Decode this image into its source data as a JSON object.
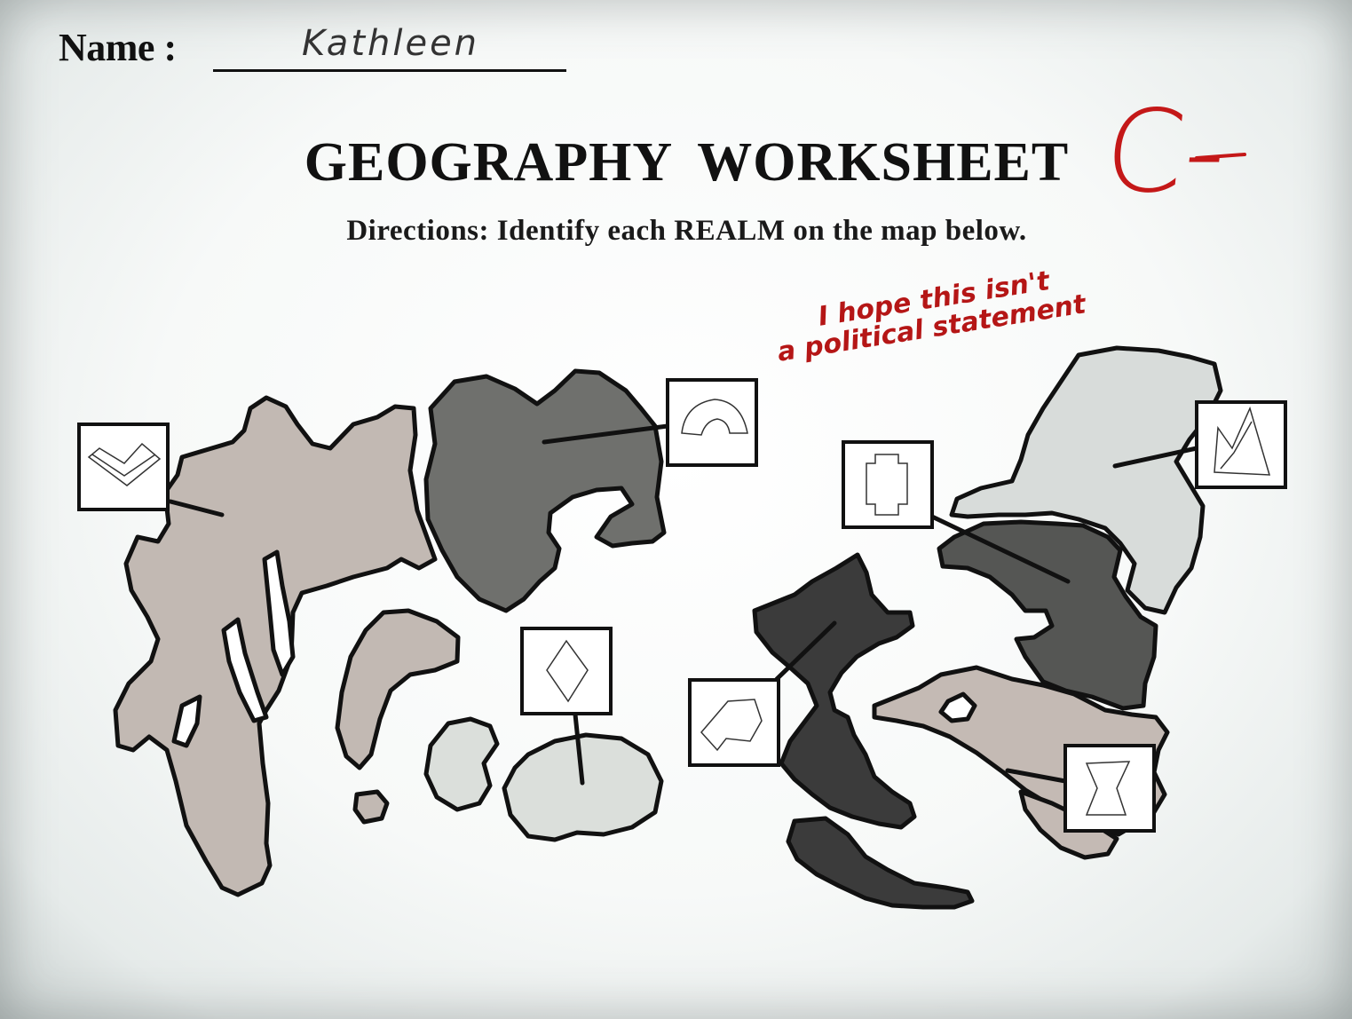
{
  "worksheet": {
    "name_label": "Name :",
    "name_value": "Kathleen",
    "title": "GEOGRAPHY WORKSHEET",
    "directions": "Directions: Identify each REALM on the map below.",
    "grade": "C-"
  },
  "teacher_note": {
    "line1": "I hope this isn't",
    "line2": "a political statement"
  },
  "map": {
    "realms": [
      {
        "id": "far-west",
        "color": "#c2b9b3",
        "symbol": "chevron-icon"
      },
      {
        "id": "north-central",
        "color": "#6f706d",
        "symbol": "arch-icon"
      },
      {
        "id": "south-central-islands",
        "color": "#dbdfdb",
        "symbol": "diamond-icon"
      },
      {
        "id": "central-east",
        "color": "#3b3b3b",
        "symbol": "pentagon-icon"
      },
      {
        "id": "northeast",
        "color": "#d8dcda",
        "symbol": "peaks-icon"
      },
      {
        "id": "east-middle",
        "color": "#555654",
        "symbol": "notched-rect-icon"
      },
      {
        "id": "southeast",
        "color": "#c4bab4",
        "symbol": "hourglass-icon"
      }
    ]
  }
}
